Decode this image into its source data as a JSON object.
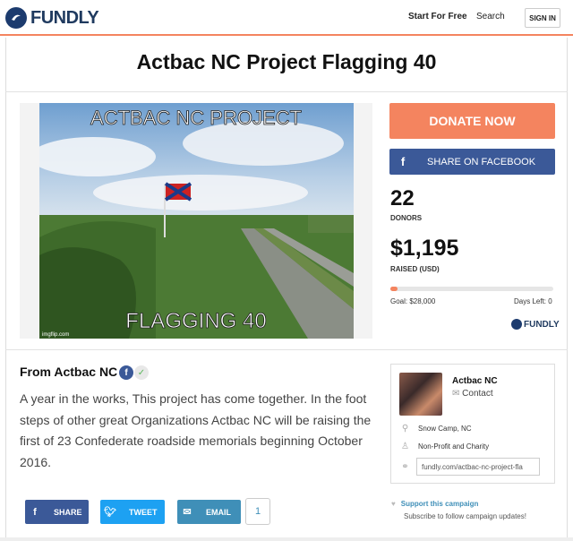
{
  "header": {
    "brand": "FUNDLY",
    "start_label": "Start For Free",
    "search_label": "Search",
    "signin_label": "SIGN IN"
  },
  "campaign": {
    "title": "Actbac NC Project Flagging 40",
    "image_text_top": "ACTBAC NC PROJECT",
    "image_text_bottom": "FLAGGING 40",
    "image_credit": "imgflip.com"
  },
  "sidebar": {
    "donate_label": "DONATE NOW",
    "share_fb_label": "SHARE ON FACEBOOK",
    "donors_count": "22",
    "donors_label": "DONORS",
    "raised_amount": "$1,195",
    "raised_label": "RAISED (USD)",
    "progress_fraction": 0.043,
    "goal_text": "Goal: $28,000",
    "days_left_text": "Days Left: 0",
    "mini_brand": "FUNDLY"
  },
  "story": {
    "from_label": "From Actbac NC",
    "text": "A year in the works, This project has come together. In the foot steps of other great Organizations Actbac NC will be raising the first of 23 Confederate roadside memorials beginning October 2016."
  },
  "share": {
    "fb_label": "SHARE",
    "tw_label": "TWEET",
    "email_label": "EMAIL",
    "count": "1"
  },
  "organizer": {
    "name": "Actbac NC",
    "contact_label": "Contact",
    "location": "Snow Camp, NC",
    "category": "Non-Profit and Charity",
    "url": "fundly.com/actbac-nc-project-fla"
  },
  "support": {
    "title": "Support this campaign",
    "subtitle": "Subscribe to follow campaign updates!"
  },
  "colors": {
    "accent": "#f4845f",
    "facebook": "#3b5998",
    "twitter": "#1da1f2",
    "brand_navy": "#1f3a5f"
  }
}
